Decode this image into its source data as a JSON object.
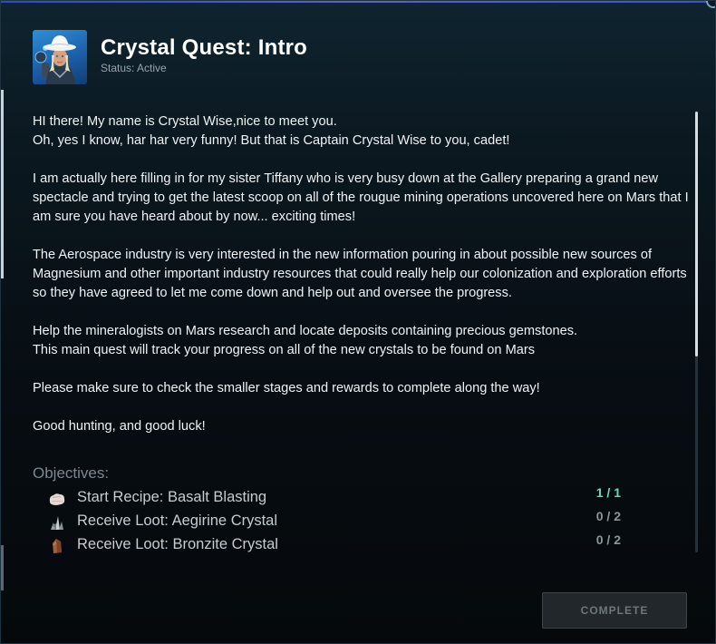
{
  "quest": {
    "title": "Crystal Quest: Intro",
    "status": "Status: Active",
    "paragraphs": [
      "HI there! My name is Crystal Wise,nice to meet you.\nOh, yes I know, har har very funny! But that is Captain Crystal Wise to you, cadet!",
      "I am actually here filling in for my sister Tiffany who is very busy down at the Gallery preparing a grand new spectacle and trying to get the latest scoop on all of the rougue mining operations uncovered here on Mars that I am sure you have heard about by now... exciting times!",
      "The Aerospace industry is very interested in the new information pouring in about possible new sources of Magnesium and other important industry resources that could really help our colonization and exploration efforts so they have agreed to let me come down and help out and oversee the progress.",
      "Help the mineralogists on Mars research and locate deposits containing precious gemstones.\nThis main quest will track your progress on all of the new crystals to be found on Mars",
      "Please make sure to check the smaller stages and rewards to complete along the way!",
      "Good hunting, and good luck!"
    ]
  },
  "objectives": {
    "heading": "Objectives:",
    "items": [
      {
        "label": "Start Recipe: Basalt Blasting",
        "progress": "1 / 1",
        "icon": "rock-icon",
        "done": true
      },
      {
        "label": "Receive Loot: Aegirine Crystal",
        "progress": "0 / 2",
        "icon": "crystal-cluster-icon",
        "done": false
      },
      {
        "label": "Receive Loot: Bronzite Crystal",
        "progress": "0 / 2",
        "icon": "crystal-shard-icon",
        "done": false
      }
    ]
  },
  "actions": {
    "complete_label": "COMPLETE",
    "complete_enabled": false
  },
  "colors": {
    "done_progress": "#5ee0b9",
    "pending_progress": "#8b959c",
    "accent": "#4f6bff"
  }
}
